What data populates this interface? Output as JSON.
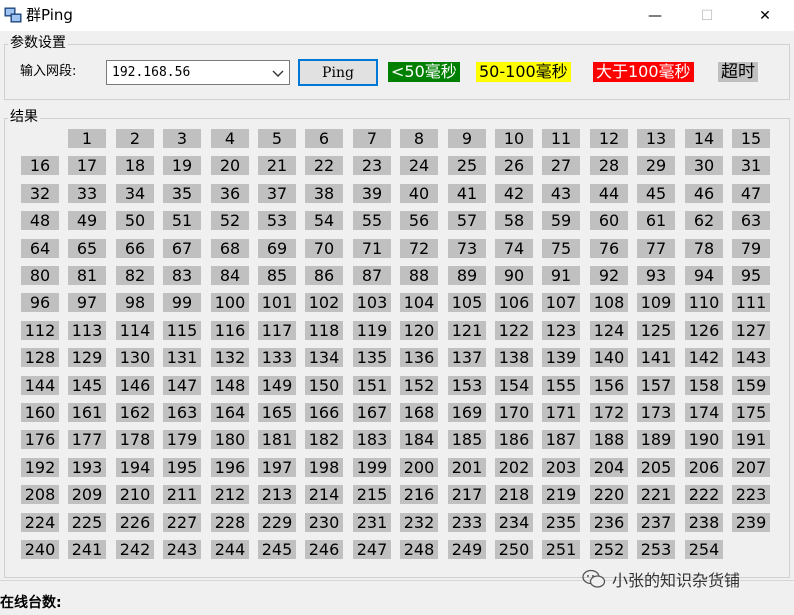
{
  "window": {
    "title": "群Ping",
    "controls": {
      "minimize": "—",
      "maximize": "☐",
      "close": "✕"
    }
  },
  "params": {
    "group_label": "参数设置",
    "field_label": "输入网段:",
    "ip_value": "192.168.56",
    "ping_label": "Ping"
  },
  "legend": {
    "fast": "<50毫秒",
    "medium": "50-100毫秒",
    "slow": "大于100毫秒",
    "timeout": "超时"
  },
  "colors": {
    "fast": "#008000",
    "medium": "#ffff00",
    "slow": "#ff0000",
    "timeout": "#c0c0c0",
    "focus_border": "#0078d7"
  },
  "results": {
    "group_label": "结果",
    "cells": [
      "1",
      "2",
      "3",
      "4",
      "5",
      "6",
      "7",
      "8",
      "9",
      "10",
      "11",
      "12",
      "13",
      "14",
      "15",
      "16",
      "17",
      "18",
      "19",
      "20",
      "21",
      "22",
      "23",
      "24",
      "25",
      "26",
      "27",
      "28",
      "29",
      "30",
      "31",
      "32",
      "33",
      "34",
      "35",
      "36",
      "37",
      "38",
      "39",
      "40",
      "41",
      "42",
      "43",
      "44",
      "45",
      "46",
      "47",
      "48",
      "49",
      "50",
      "51",
      "52",
      "53",
      "54",
      "55",
      "56",
      "57",
      "58",
      "59",
      "60",
      "61",
      "62",
      "63",
      "64",
      "65",
      "66",
      "67",
      "68",
      "69",
      "70",
      "71",
      "72",
      "73",
      "74",
      "75",
      "76",
      "77",
      "78",
      "79",
      "80",
      "81",
      "82",
      "83",
      "84",
      "85",
      "86",
      "87",
      "88",
      "89",
      "90",
      "91",
      "92",
      "93",
      "94",
      "95",
      "96",
      "97",
      "98",
      "99",
      "100",
      "101",
      "102",
      "103",
      "104",
      "105",
      "106",
      "107",
      "108",
      "109",
      "110",
      "111",
      "112",
      "113",
      "114",
      "115",
      "116",
      "117",
      "118",
      "119",
      "120",
      "121",
      "122",
      "123",
      "124",
      "125",
      "126",
      "127",
      "128",
      "129",
      "130",
      "131",
      "132",
      "133",
      "134",
      "135",
      "136",
      "137",
      "138",
      "139",
      "140",
      "141",
      "142",
      "143",
      "144",
      "145",
      "146",
      "147",
      "148",
      "149",
      "150",
      "151",
      "152",
      "153",
      "154",
      "155",
      "156",
      "157",
      "158",
      "159",
      "160",
      "161",
      "162",
      "163",
      "164",
      "165",
      "166",
      "167",
      "168",
      "169",
      "170",
      "171",
      "172",
      "173",
      "174",
      "175",
      "176",
      "177",
      "178",
      "179",
      "180",
      "181",
      "182",
      "183",
      "184",
      "185",
      "186",
      "187",
      "188",
      "189",
      "190",
      "191",
      "192",
      "193",
      "194",
      "195",
      "196",
      "197",
      "198",
      "199",
      "200",
      "201",
      "202",
      "203",
      "204",
      "205",
      "206",
      "207",
      "208",
      "209",
      "210",
      "211",
      "212",
      "213",
      "214",
      "215",
      "216",
      "217",
      "218",
      "219",
      "220",
      "221",
      "222",
      "223",
      "224",
      "225",
      "226",
      "227",
      "228",
      "229",
      "230",
      "231",
      "232",
      "233",
      "234",
      "235",
      "236",
      "237",
      "238",
      "239",
      "240",
      "241",
      "242",
      "243",
      "244",
      "245",
      "246",
      "247",
      "248",
      "249",
      "250",
      "251",
      "252",
      "253",
      "254"
    ]
  },
  "status": {
    "online_label": "在线台数:"
  },
  "watermark": {
    "text": "小张的知识杂货铺",
    "icon": "wechat-icon"
  }
}
